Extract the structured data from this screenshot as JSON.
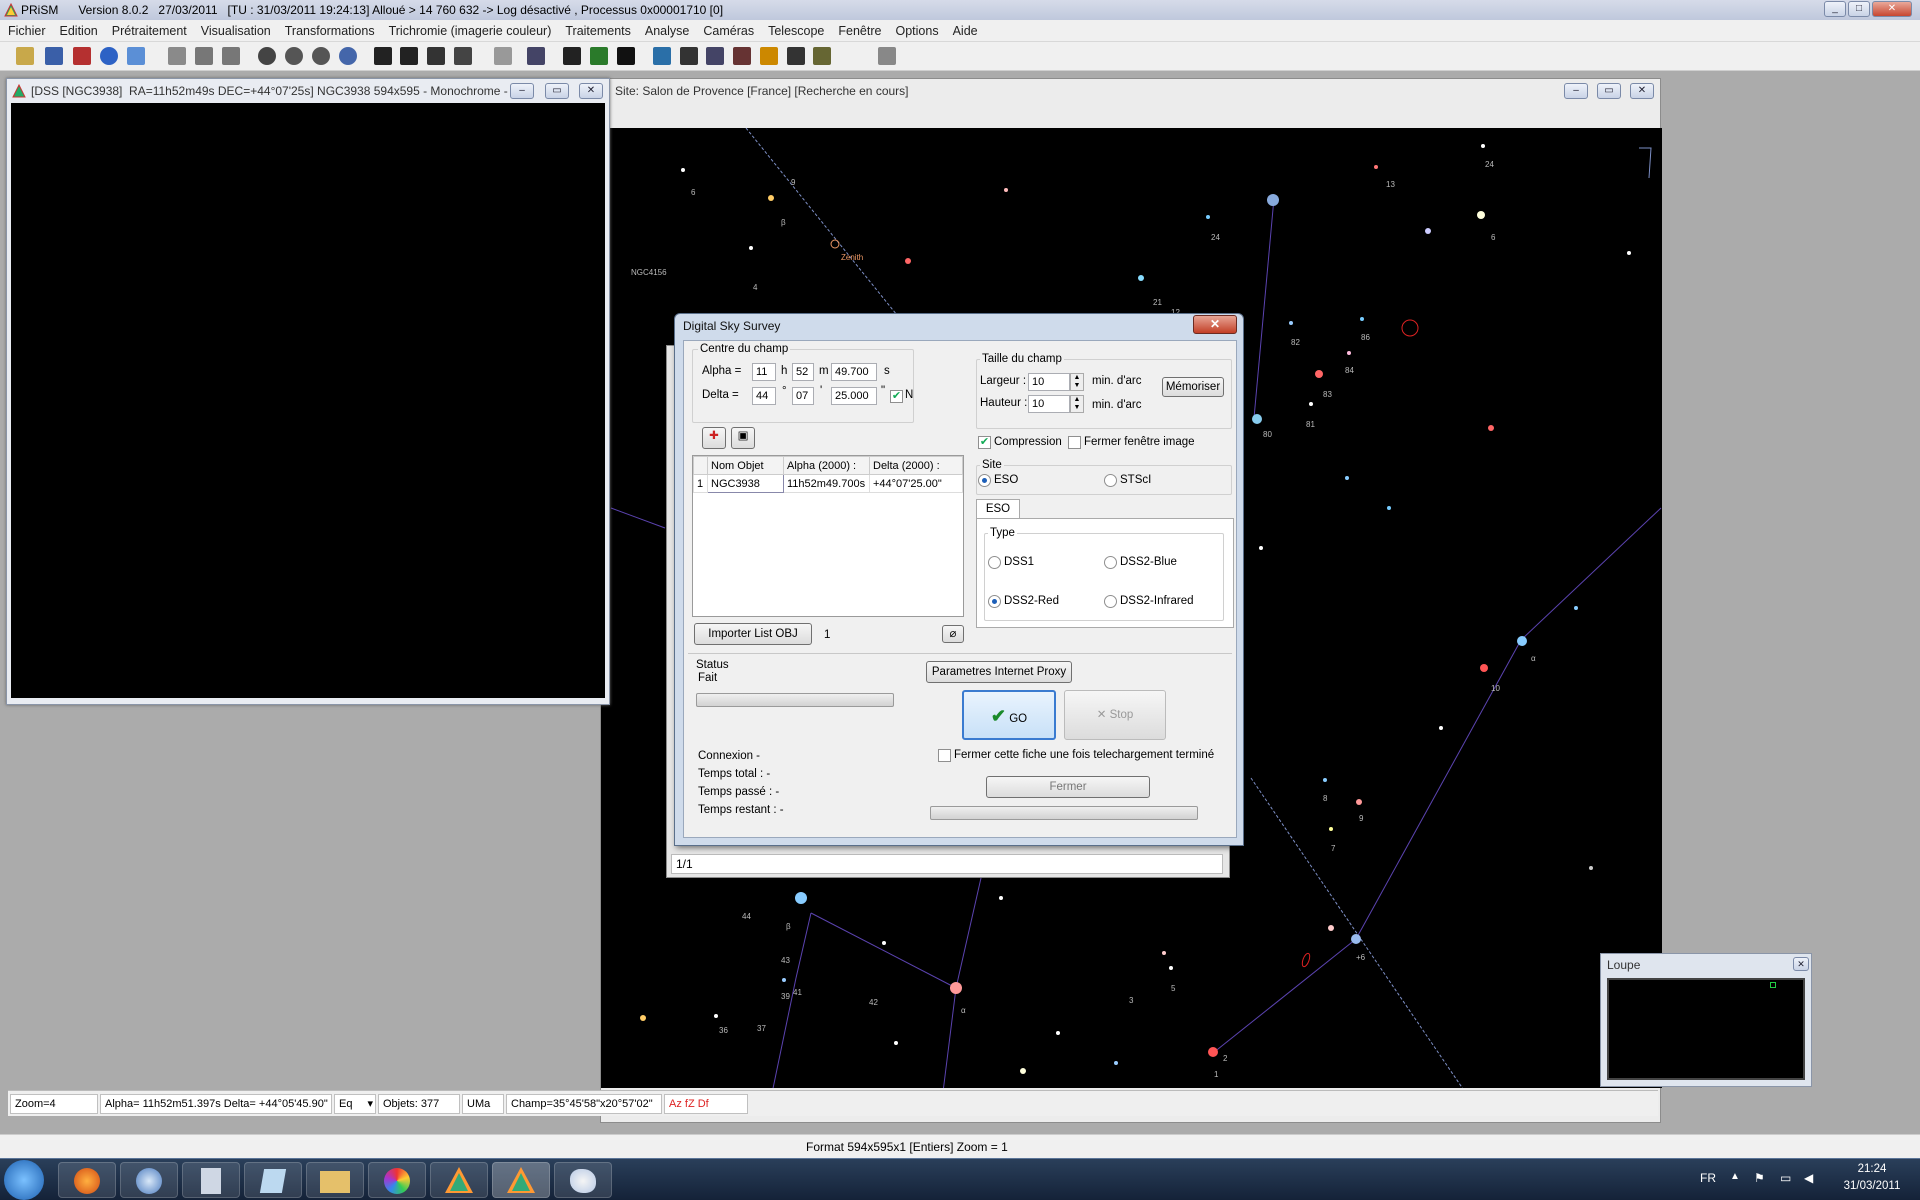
{
  "app": {
    "title": "PRiSM      Version 8.0.2   27/03/2011   [TU : 31/03/2011 19:24:13] Alloué > 14 760 632 -> Log désactivé , Processus 0x00001710 [0]"
  },
  "menu": [
    "Fichier",
    "Edition",
    "Prétraitement",
    "Visualisation",
    "Transformations",
    "Trichromie (imagerie couleur)",
    "Traitements",
    "Analyse",
    "Caméras",
    "Telescope",
    "Fenêtre",
    "Options",
    "Aide"
  ],
  "chart_window": {
    "title": "Site: Salon de Provence [France] [Recherche en cours]"
  },
  "dss_window": {
    "title": "[DSS [NGC3938]  RA=11h52m49s DEC=+44°07'25s] NGC3938 594x595 - Monochrome - ..."
  },
  "sky_labels": [
    "9",
    "6",
    "β",
    "Zenith",
    "NGC4156",
    "4",
    "13",
    "24",
    "24",
    "12",
    "6",
    "21",
    "82",
    "86",
    "84",
    "83",
    "80",
    "81",
    "α",
    "10",
    "8",
    "9",
    "7",
    "+6",
    "2",
    "1",
    "5",
    "3",
    "42",
    "44",
    "β",
    "43",
    "41",
    "39",
    "36",
    "37",
    "α",
    "32",
    "β",
    "21",
    "19",
    "10",
    "43",
    "42",
    "1",
    "37"
  ],
  "dialog": {
    "title": "Digital Sky Survey",
    "centre_group": "Centre du champ",
    "alpha_label": "Alpha =",
    "alpha_h": "11",
    "h_unit": "h",
    "alpha_m": "52",
    "m_unit": "m",
    "alpha_s": "49.700",
    "s_unit": "s",
    "delta_label": "Delta =",
    "delta_d": "44",
    "deg_unit": "°",
    "delta_m": "07",
    "min_unit": "'",
    "delta_s": "25.000",
    "sec_unit": "\"",
    "north_label": "N",
    "table": {
      "headers": [
        "Nom Objet",
        "Alpha (2000) :",
        "Delta (2000) :"
      ],
      "rows": [
        {
          "idx": "1",
          "name": "NGC3938",
          "alpha": "11h52m49.700s",
          "delta": "+44°07'25.00\""
        }
      ]
    },
    "import_button": "Importer List OBJ",
    "import_count": "1",
    "taille_group": "Taille du champ",
    "largeur_label": "Largeur :",
    "largeur_value": "10",
    "hauteur_label": "Hauteur :",
    "hauteur_value": "10",
    "arcmin_label": "min. d'arc",
    "memoriser_button": "Mémoriser",
    "compression_label": "Compression",
    "fermer_image_label": "Fermer fenêtre image",
    "site_group": "Site",
    "site_eso": "ESO",
    "site_stsci": "STScI",
    "tab_eso": "ESO",
    "type_group": "Type",
    "types": [
      "DSS1",
      "DSS2-Blue",
      "DSS2-Red",
      "DSS2-Infrared"
    ],
    "selected_type": "DSS2-Red",
    "status_label": "Status",
    "status_value": "Fait",
    "proxy_button": "Parametres Internet Proxy",
    "go_button": "GO",
    "stop_button": "Stop",
    "close_after_label": "Fermer cette fiche une fois telechargement terminé",
    "fermer_button": "Fermer",
    "connexion": "Connexion  -",
    "temps_total": "Temps total :    -",
    "temps_passe": "Temps passé :    -",
    "temps_restant": "Temps restant :   -",
    "behind_counter": "1/1"
  },
  "chart_status": {
    "zoom": "Zoom=4",
    "coords": "Alpha= 11h52m51.397s Delta= +44°05'45.90\"",
    "eq": "Eq",
    "objets": "Objets: 377",
    "const": "UMa",
    "champ": "Champ=35°45'58\"x20°57'02\"",
    "az": "Az fZ Df"
  },
  "app_status": "Format 594x595x1  [Entiers]  Zoom = 1",
  "loupe": {
    "title": "Loupe"
  },
  "taskbar": {
    "lang": "FR",
    "time": "21:24",
    "date": "31/03/2011"
  },
  "colors": {
    "sky": "#000000",
    "constellation": "#6a4fc4",
    "chart_line": "#7d8fc6",
    "desktop": "#ababab",
    "taskbar": "#1e314c"
  }
}
